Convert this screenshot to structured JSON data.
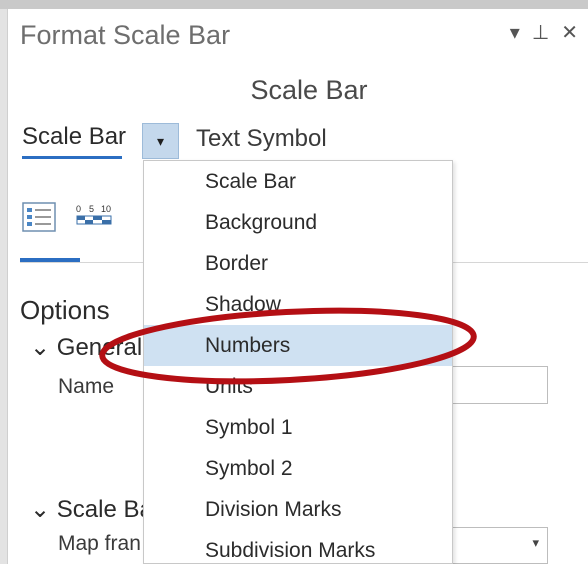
{
  "pane": {
    "title": "Format Scale Bar",
    "subtitle": "Scale Bar",
    "window_controls": [
      "▾",
      "⊥",
      "✕"
    ]
  },
  "tabs": {
    "scale_bar": "Scale Bar",
    "text_symbol": "Text Symbol",
    "dropdown_arrow": "▾"
  },
  "toolbar": {
    "icons": [
      "properties-list-icon",
      "scale-bar-icon"
    ],
    "scale_labels": [
      "0",
      "5",
      "10"
    ]
  },
  "options": {
    "heading": "Options",
    "general": {
      "label": "General",
      "chevron": "⌄"
    },
    "name_label": "Name",
    "name_value": "",
    "scale_bar_group": {
      "label": "Scale Ba",
      "chevron": "⌄"
    },
    "map_frame_label": "Map fran",
    "map_frame_value": "",
    "map_frame_arrow": "▾"
  },
  "dropdown": {
    "selected_index": 4,
    "items": [
      "Scale Bar",
      "Background",
      "Border",
      "Shadow",
      "Numbers",
      "Units",
      "Symbol 1",
      "Symbol 2",
      "Division Marks",
      "Subdivision Marks"
    ]
  },
  "colors": {
    "accent": "#2b6ec2",
    "highlight": "#cfe1f2",
    "annotation": "#b40f14"
  }
}
